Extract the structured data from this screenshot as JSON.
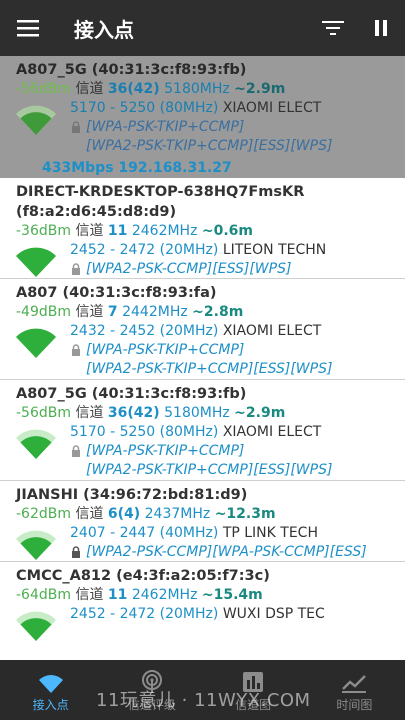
{
  "app": {
    "title": "接入点"
  },
  "colors": {
    "appbar": "#2e2e2e",
    "signal": "#4caf50",
    "accent": "#1e90c8",
    "active_tab": "#4db8ff"
  },
  "icons": {
    "menu": "hamburger-menu-icon",
    "filter": "filter-icon",
    "pause": "pause-icon"
  },
  "connected": {
    "name": "A807_5G (40:31:3c:f8:93:fb)",
    "dbm": "-56dBm",
    "channel_label": "信道",
    "channel": "36(42)",
    "freq": "5180MHz",
    "distance": "~2.9m",
    "range": "5170 - 5250 (80MHz)",
    "vendor": "XIAOMI ELECT",
    "sec1": "[WPA-PSK-TKIP+CCMP]",
    "sec2": "[WPA2-PSK-TKIP+CCMP][ESS][WPS]",
    "speed": "433Mbps 192.168.31.27"
  },
  "networks": [
    {
      "name": "DIRECT-KRDESKTOP-638HQ7FmsKR",
      "name2": "(f8:a2:d6:45:d8:d9)",
      "dbm": "-36dBm",
      "channel_label": "信道",
      "channel": "11",
      "freq": "2462MHz",
      "distance": "~0.6m",
      "range": "2452 - 2472 (20MHz)",
      "vendor": "LITEON TECHN",
      "sec1": "[WPA2-PSK-CCMP][ESS][WPS]",
      "sec2": "",
      "signal_level": 4
    },
    {
      "name": "A807 (40:31:3c:f8:93:fa)",
      "dbm": "-49dBm",
      "channel_label": "信道",
      "channel": "7",
      "freq": "2442MHz",
      "distance": "~2.8m",
      "range": "2432 - 2452 (20MHz)",
      "vendor": "XIAOMI ELECT",
      "sec1": "[WPA-PSK-TKIP+CCMP]",
      "sec2": "[WPA2-PSK-TKIP+CCMP][ESS][WPS]",
      "signal_level": 4
    },
    {
      "name": "A807_5G (40:31:3c:f8:93:fb)",
      "dbm": "-56dBm",
      "channel_label": "信道",
      "channel": "36(42)",
      "freq": "5180MHz",
      "distance": "~2.9m",
      "range": "5170 - 5250 (80MHz)",
      "vendor": "XIAOMI ELECT",
      "sec1": "[WPA-PSK-TKIP+CCMP]",
      "sec2": "[WPA2-PSK-TKIP+CCMP][ESS][WPS]",
      "signal_level": 3
    },
    {
      "name": "JIANSHI (34:96:72:bd:81:d9)",
      "dbm": "-62dBm",
      "channel_label": "信道",
      "channel": "6(4)",
      "freq": "2437MHz",
      "distance": "~12.3m",
      "range": "2407 - 2447 (40MHz)",
      "vendor": "TP LINK TECH",
      "sec1": "[WPA2-PSK-CCMP][WPA-PSK-CCMP][ESS]",
      "sec2": "",
      "signal_level": 3
    },
    {
      "name": "CMCC_A812 (e4:3f:a2:05:f7:3c)",
      "dbm": "-64dBm",
      "channel_label": "信道",
      "channel": "11",
      "freq": "2462MHz",
      "distance": "~15.4m",
      "range": "2452 - 2472 (20MHz)",
      "vendor": "WUXI DSP TEC",
      "sec1": "",
      "sec2": "",
      "signal_level": 3
    }
  ],
  "tabs": [
    {
      "label": "接入点",
      "icon": "wifi-icon",
      "active": true
    },
    {
      "label": "信道评级",
      "icon": "radar-icon",
      "active": false
    },
    {
      "label": "信道图",
      "icon": "bar-chart-icon",
      "active": false
    },
    {
      "label": "时间图",
      "icon": "line-chart-icon",
      "active": false
    }
  ],
  "watermark": "11玩意儿 · 11WYX.COM"
}
